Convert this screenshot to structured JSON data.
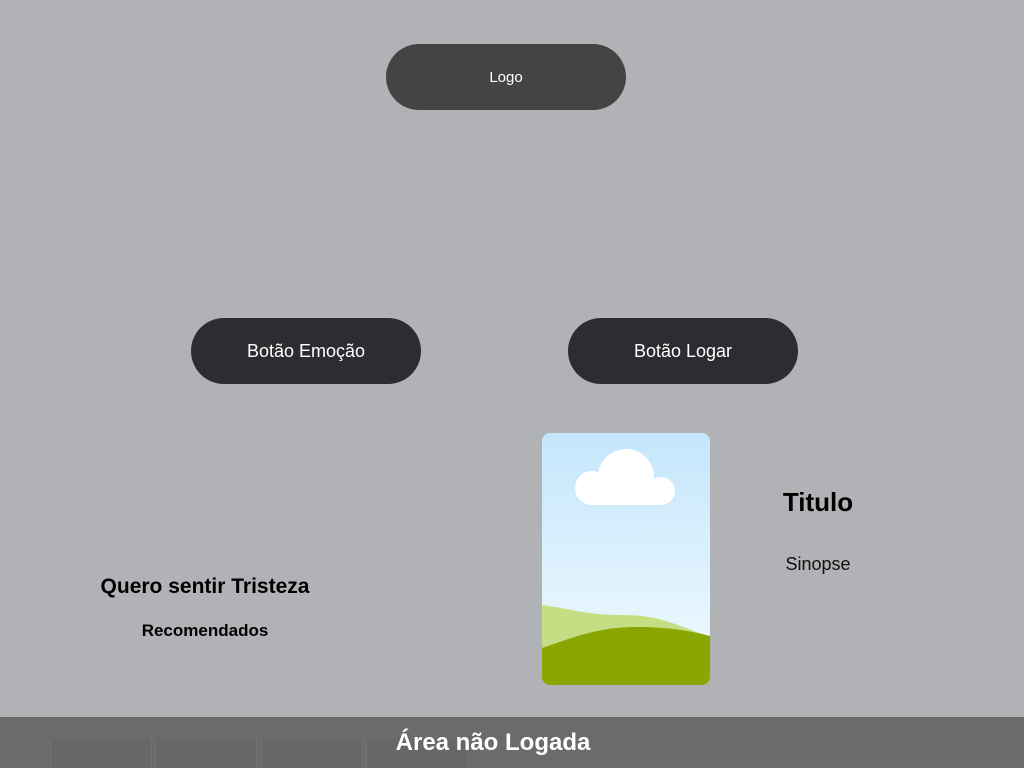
{
  "header": {
    "logo_label": "Logo"
  },
  "actions": {
    "emotion_button_label": "Botão Emoção",
    "login_button_label": "Botão Logar"
  },
  "recommendations": {
    "emotion_heading": "Quero sentir Tristeza",
    "section_label": "Recomendados"
  },
  "movie": {
    "poster_icon": "image-placeholder-icon",
    "title": "Titulo",
    "synopsis": "Sinopse"
  },
  "footer": {
    "label": "Área não Logada"
  },
  "colors": {
    "background": "#b1b2b5",
    "logo_bg": "#444444",
    "button_bg": "#2c2d30",
    "footer_bg": "#6b6b6b",
    "sky_top": "#c4e6fc",
    "grass": "#8aa600"
  }
}
